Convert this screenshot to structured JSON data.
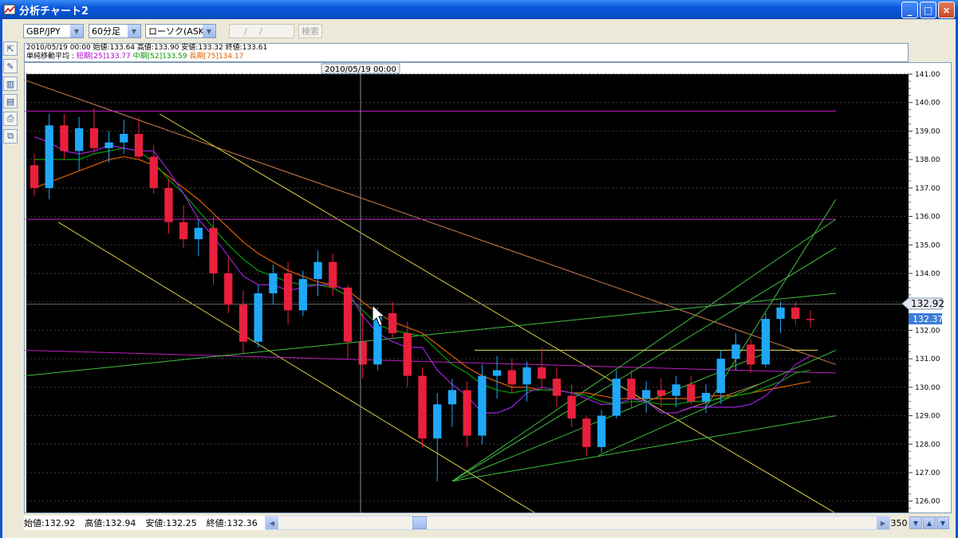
{
  "window": {
    "title": "分析チャート2",
    "controls": {
      "minimize": "_",
      "maximize": "□",
      "close": "×"
    }
  },
  "toolbar": {
    "pair": "GBP/JPY",
    "interval": "60分足",
    "chart_type": "ローソク(ASK)",
    "date_field": "/ /",
    "search_label": "検索",
    "side_tools": [
      "cursor-icon",
      "pen-icon",
      "bar-chart-icon",
      "indicator-icon",
      "print-icon",
      "copy-icon"
    ]
  },
  "info": {
    "line1": "2010/05/19 00:00  始値:133.64  高値:133.90  安値:133.32  終値:133.61",
    "ma_title": "単純移動平均 :",
    "ma_short": "短期[25]133.77",
    "ma_mid": "中期[52]133.59",
    "ma_long": "長期[75]134.17",
    "colors": {
      "short": "#B000D0",
      "mid": "#009900",
      "long": "#E06000"
    }
  },
  "chart": {
    "cursor_time": "2010/05/19 00:00",
    "current_price": "132.92",
    "cursor_price": "132.37",
    "axis_labels": [
      "141.00",
      "140.00",
      "139.00",
      "138.00",
      "137.00",
      "136.00",
      "135.00",
      "134.00",
      "133.00",
      "132.00",
      "131.00",
      "130.00",
      "129.00",
      "128.00",
      "127.00",
      "126.00"
    ],
    "colors": {
      "bg": "#000000",
      "up": "#20A8F8",
      "down": "#E8203C"
    }
  },
  "chart_data": {
    "type": "candlestick",
    "symbol": "GBP/JPY",
    "ylim": [
      125.6,
      141.0
    ],
    "ma_short": [
      138.8,
      138.6,
      138.3,
      138.2,
      138.3,
      138.5,
      138.4,
      138.3,
      138.3,
      137.6,
      136.8,
      135.9,
      135.3,
      134.6,
      133.9,
      133.6,
      133.6,
      133.4,
      133.5,
      133.6,
      133.6,
      133.4,
      132.5,
      131.9,
      131.6,
      131.4,
      131.4,
      130.6,
      130.1,
      129.7,
      129.1,
      129.1,
      129.3,
      129.8,
      130.0,
      129.9,
      129.8,
      129.6,
      129.4,
      129.4,
      129.6,
      129.5,
      129.1,
      129.1,
      129.3,
      129.3,
      129.3,
      129.3,
      129.4,
      129.7,
      130.2,
      130.8,
      131.1
    ],
    "ma_mid": [
      138.0,
      138.0,
      138.0,
      138.0,
      138.2,
      138.3,
      138.4,
      138.3,
      137.9,
      137.3,
      136.8,
      136.2,
      135.6,
      135.0,
      134.5,
      134.1,
      133.9,
      133.7,
      133.6,
      133.6,
      133.5,
      133.2,
      132.7,
      132.2,
      132.0,
      131.9,
      131.8,
      131.3,
      130.8,
      130.5,
      130.1,
      129.9,
      129.8,
      129.9,
      129.9,
      129.9,
      129.8,
      129.7,
      129.5,
      129.4,
      129.5,
      129.5,
      129.4,
      129.4,
      129.5,
      129.5,
      129.6,
      129.7,
      129.8,
      130.0,
      130.2,
      130.5,
      130.6
    ],
    "ma_long": [
      137.0,
      137.2,
      137.4,
      137.6,
      137.8,
      138.0,
      138.1,
      138.0,
      137.8,
      137.4,
      137.0,
      136.6,
      136.1,
      135.6,
      135.1,
      134.7,
      134.4,
      134.1,
      133.9,
      133.7,
      133.6,
      133.4,
      133.0,
      132.6,
      132.3,
      132.1,
      131.9,
      131.5,
      131.1,
      130.7,
      130.4,
      130.2,
      130.0,
      130.0,
      129.9,
      129.9,
      129.8,
      129.8,
      129.7,
      129.6,
      129.6,
      129.6,
      129.6,
      129.6,
      129.6,
      129.7,
      129.7,
      129.7,
      129.8,
      129.9,
      130.0,
      130.1,
      130.2
    ],
    "candles": [
      [
        137.8,
        138.2,
        136.7,
        137.0
      ],
      [
        137.0,
        139.6,
        136.6,
        139.2
      ],
      [
        139.2,
        139.6,
        138.0,
        138.3
      ],
      [
        138.3,
        139.5,
        137.6,
        139.1
      ],
      [
        139.1,
        139.8,
        138.2,
        138.4
      ],
      [
        138.4,
        139.0,
        137.9,
        138.6
      ],
      [
        138.6,
        139.4,
        138.2,
        138.9
      ],
      [
        138.9,
        139.5,
        138.0,
        138.1
      ],
      [
        138.1,
        138.5,
        136.8,
        137.0
      ],
      [
        137.0,
        137.3,
        135.4,
        135.8
      ],
      [
        135.8,
        136.4,
        134.9,
        135.2
      ],
      [
        135.2,
        135.9,
        134.6,
        135.6
      ],
      [
        135.6,
        136.0,
        133.6,
        134.0
      ],
      [
        134.0,
        134.6,
        132.6,
        132.9
      ],
      [
        132.9,
        133.4,
        131.2,
        131.6
      ],
      [
        131.6,
        133.6,
        131.4,
        133.3
      ],
      [
        133.3,
        134.3,
        132.9,
        134.0
      ],
      [
        134.0,
        134.4,
        132.2,
        132.7
      ],
      [
        132.7,
        134.1,
        132.5,
        133.8
      ],
      [
        133.8,
        134.8,
        133.2,
        134.4
      ],
      [
        134.4,
        134.7,
        133.2,
        133.5
      ],
      [
        133.5,
        133.6,
        131.0,
        131.6
      ],
      [
        131.6,
        132.6,
        130.3,
        130.8
      ],
      [
        130.8,
        132.8,
        130.6,
        132.6
      ],
      [
        132.6,
        133.0,
        131.7,
        131.9
      ],
      [
        131.9,
        132.3,
        130.0,
        130.4
      ],
      [
        130.4,
        130.7,
        127.9,
        128.2
      ],
      [
        128.2,
        129.8,
        126.7,
        129.4
      ],
      [
        129.4,
        130.3,
        128.6,
        129.9
      ],
      [
        129.9,
        130.2,
        127.9,
        128.3
      ],
      [
        128.3,
        130.8,
        128.0,
        130.4
      ],
      [
        130.4,
        131.1,
        129.6,
        130.6
      ],
      [
        130.6,
        131.0,
        129.8,
        130.1
      ],
      [
        130.1,
        130.9,
        129.5,
        130.7
      ],
      [
        130.7,
        131.4,
        129.9,
        130.3
      ],
      [
        130.3,
        130.7,
        129.3,
        129.7
      ],
      [
        129.7,
        130.1,
        128.6,
        128.9
      ],
      [
        128.9,
        129.0,
        127.6,
        127.9
      ],
      [
        127.9,
        129.2,
        127.7,
        129.0
      ],
      [
        129.0,
        130.6,
        128.9,
        130.3
      ],
      [
        130.3,
        130.6,
        129.3,
        129.6
      ],
      [
        129.6,
        130.2,
        129.1,
        129.9
      ],
      [
        129.9,
        130.3,
        129.3,
        129.7
      ],
      [
        129.7,
        130.4,
        129.3,
        130.1
      ],
      [
        130.1,
        130.4,
        129.4,
        129.5
      ],
      [
        129.5,
        130.1,
        129.1,
        129.8
      ],
      [
        129.8,
        131.3,
        129.4,
        131.0
      ],
      [
        131.0,
        131.9,
        130.6,
        131.5
      ],
      [
        131.5,
        131.7,
        130.5,
        130.8
      ],
      [
        130.8,
        132.6,
        130.7,
        132.4
      ],
      [
        132.4,
        133.0,
        131.9,
        132.8
      ],
      [
        132.8,
        133.0,
        132.2,
        132.4
      ],
      [
        132.4,
        132.7,
        132.1,
        132.36
      ]
    ]
  },
  "status": {
    "open": "始値:132.92",
    "high": "高値:132.94",
    "low": "安値:132.25",
    "close": "終値:132.36"
  },
  "zoom": {
    "value": "350"
  }
}
